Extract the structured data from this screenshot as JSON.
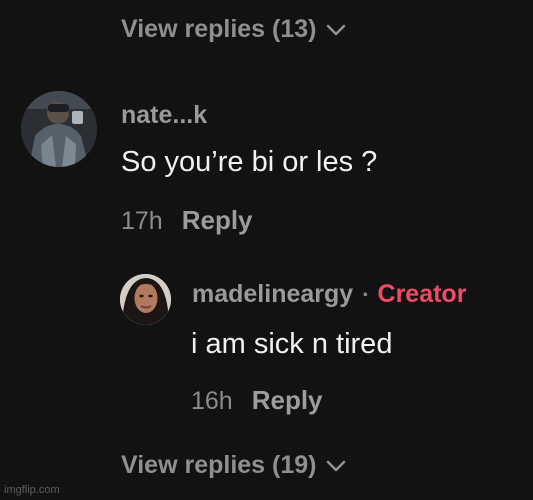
{
  "thread": {
    "top_view_replies": "View replies (13)",
    "bottom_view_replies": "View replies (19)"
  },
  "comment": {
    "username": "nate...k",
    "text": "So you’re bi or les ?",
    "time": "17h",
    "reply_label": "Reply"
  },
  "reply": {
    "username": "madelineargy",
    "separator": "·",
    "badge": "Creator",
    "text": "i am sick n tired",
    "time": "16h",
    "reply_label": "Reply"
  },
  "watermark": "imgflip.com",
  "colors": {
    "background": "#121212",
    "creator_badge": "#f04a67",
    "muted_text": "#8f8f8f",
    "body_text": "#f1f1f1"
  },
  "icons": {
    "expand": "chevron-down-icon"
  }
}
